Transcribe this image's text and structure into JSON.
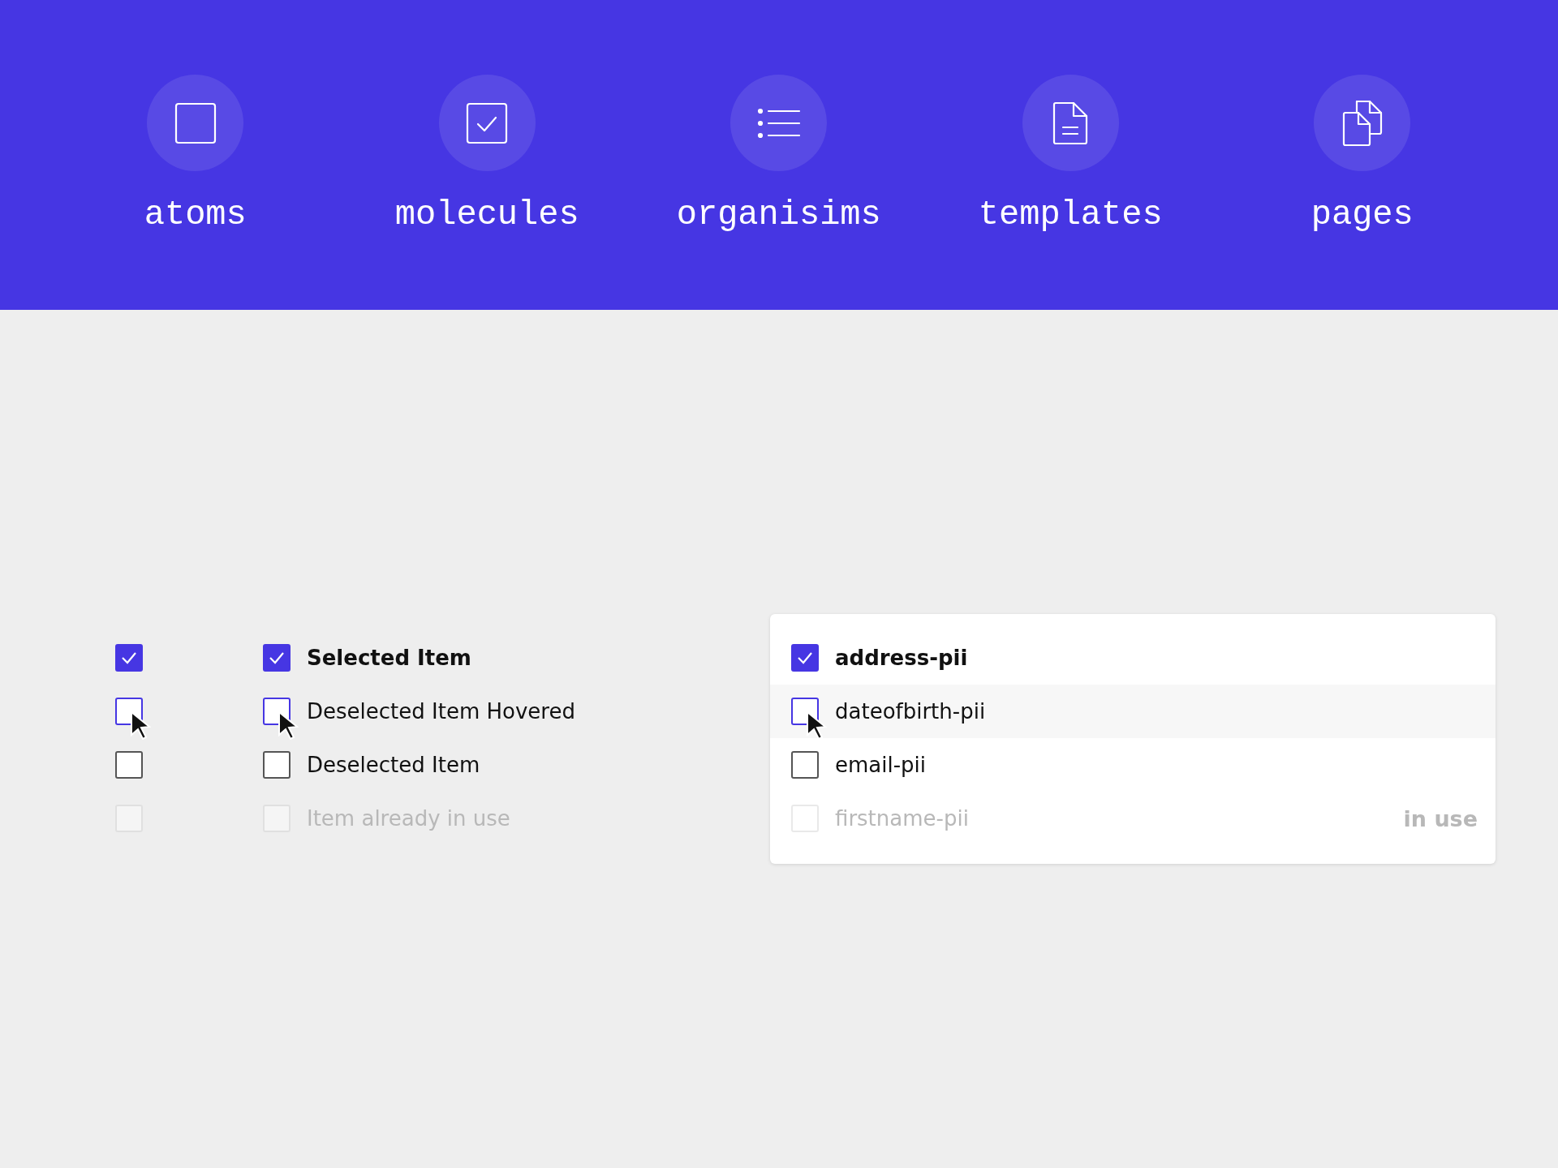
{
  "nav": [
    {
      "label": "atoms",
      "kind": "square"
    },
    {
      "label": "molecules",
      "kind": "checkbox"
    },
    {
      "label": "organisims",
      "kind": "list"
    },
    {
      "label": "templates",
      "kind": "document"
    },
    {
      "label": "pages",
      "kind": "pages"
    }
  ],
  "plain_checkboxes": [
    {
      "checked": true,
      "hovered": false,
      "disabled": false
    },
    {
      "checked": false,
      "hovered": true,
      "disabled": false
    },
    {
      "checked": false,
      "hovered": false,
      "disabled": false
    },
    {
      "checked": false,
      "hovered": false,
      "disabled": true
    }
  ],
  "labeled_checkboxes": [
    {
      "label": "Selected Item",
      "checked": true,
      "hovered": false,
      "disabled": false
    },
    {
      "label": "Deselected Item Hovered",
      "checked": false,
      "hovered": true,
      "disabled": false
    },
    {
      "label": "Deselected Item",
      "checked": false,
      "hovered": false,
      "disabled": false
    },
    {
      "label": "Item already in use",
      "checked": false,
      "hovered": false,
      "disabled": true
    }
  ],
  "card": {
    "items": [
      {
        "label": "address-pii",
        "checked": true,
        "hovered": false,
        "disabled": false
      },
      {
        "label": "dateofbirth-pii",
        "checked": false,
        "hovered": true,
        "disabled": false
      },
      {
        "label": "email-pii",
        "checked": false,
        "hovered": false,
        "disabled": false
      },
      {
        "label": "firstname-pii",
        "checked": false,
        "hovered": false,
        "disabled": true,
        "note": "in use"
      }
    ]
  }
}
